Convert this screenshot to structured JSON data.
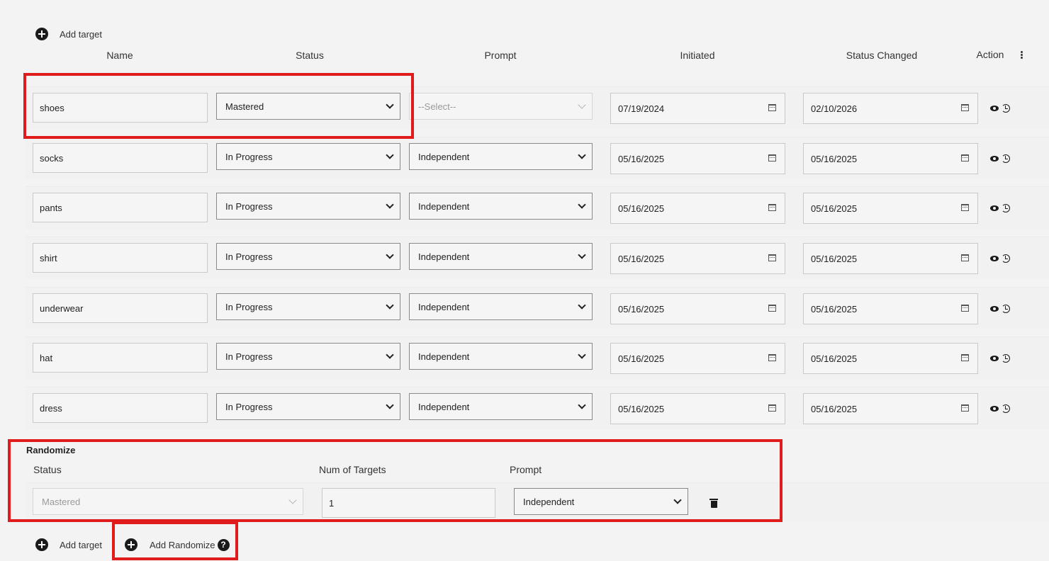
{
  "top_add_target": {
    "label": "Add target"
  },
  "columns": {
    "name": "Name",
    "status": "Status",
    "prompt": "Prompt",
    "initiated": "Initiated",
    "status_changed": "Status Changed",
    "action": "Action"
  },
  "targets": [
    {
      "name": "shoes",
      "status": "Mastered",
      "prompt": "--Select--",
      "prompt_disabled": true,
      "initiated": "07/19/2024",
      "status_changed": "02/10/2026"
    },
    {
      "name": "socks",
      "status": "In Progress",
      "prompt": "Independent",
      "initiated": "05/16/2025",
      "status_changed": "05/16/2025"
    },
    {
      "name": "pants",
      "status": "In Progress",
      "prompt": "Independent",
      "initiated": "05/16/2025",
      "status_changed": "05/16/2025"
    },
    {
      "name": "shirt",
      "status": "In Progress",
      "prompt": "Independent",
      "initiated": "05/16/2025",
      "status_changed": "05/16/2025"
    },
    {
      "name": "underwear",
      "status": "In Progress",
      "prompt": "Independent",
      "initiated": "05/16/2025",
      "status_changed": "05/16/2025"
    },
    {
      "name": "hat",
      "status": "In Progress",
      "prompt": "Independent",
      "initiated": "05/16/2025",
      "status_changed": "05/16/2025"
    },
    {
      "name": "dress",
      "status": "In Progress",
      "prompt": "Independent",
      "initiated": "05/16/2025",
      "status_changed": "05/16/2025"
    }
  ],
  "randomize": {
    "title": "Randomize",
    "status_label": "Status",
    "num_targets_label": "Num of Targets",
    "prompt_label": "Prompt",
    "status_value": "Mastered",
    "num_targets_value": "1",
    "prompt_value": "Independent"
  },
  "bottom": {
    "add_target": "Add target",
    "add_randomize": "Add Randomize",
    "help_glyph": "?"
  },
  "colors": {
    "highlight": "#e01b1b",
    "icon": "#1a1a1a"
  }
}
